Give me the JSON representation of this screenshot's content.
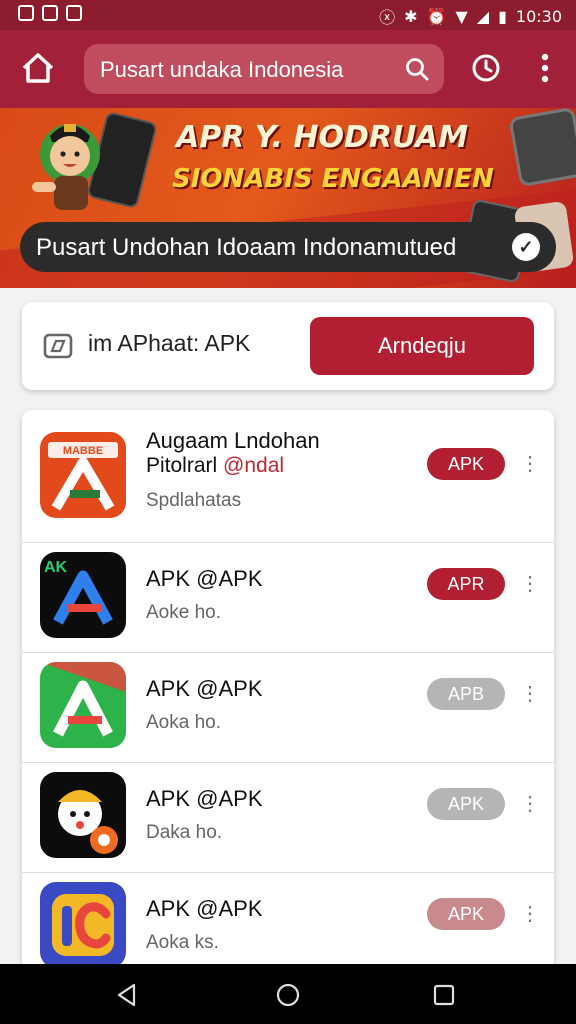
{
  "status_bar": {
    "time": "10:30"
  },
  "app_bar": {
    "search_text": "Pusart undaka Indonesia",
    "icons": [
      "home-icon",
      "search-icon",
      "history-icon",
      "more-vert-icon"
    ]
  },
  "banner": {
    "title": "APR Y. HODRUAM",
    "subtitle": "SIONABIS ENGAANIEN",
    "pill_text": "Pusart Undohan Idoaam Indonamutued"
  },
  "filter": {
    "label": "im APhaat: APK",
    "button_label": "Arndeqju"
  },
  "apps": [
    {
      "title": "Augaam Lndohan",
      "line2_prefix": "Pitolrarl ",
      "line2_accent": "@ndal",
      "subtitle": "Spdlahatas",
      "icon_badge": "MABBE",
      "button_label": "APK",
      "button_color": "#b21f33"
    },
    {
      "title": "APK @APK",
      "subtitle": "Aoke ho.",
      "icon_badge": "AK",
      "button_label": "APR",
      "button_color": "#b21f33"
    },
    {
      "title": "APK @APK",
      "subtitle": "Aoka ho.",
      "button_label": "APB",
      "button_color": "#b5b5b5"
    },
    {
      "title": "APK @APK",
      "subtitle": "Daka ho.",
      "button_label": "APK",
      "button_color": "#b5b5b5"
    },
    {
      "title": "APK @APK",
      "subtitle": "Aoka ks.",
      "button_label": "APK",
      "button_color": "#c98a8e"
    }
  ],
  "colors": {
    "primary": "#a3203a",
    "accent": "#b21f33"
  }
}
